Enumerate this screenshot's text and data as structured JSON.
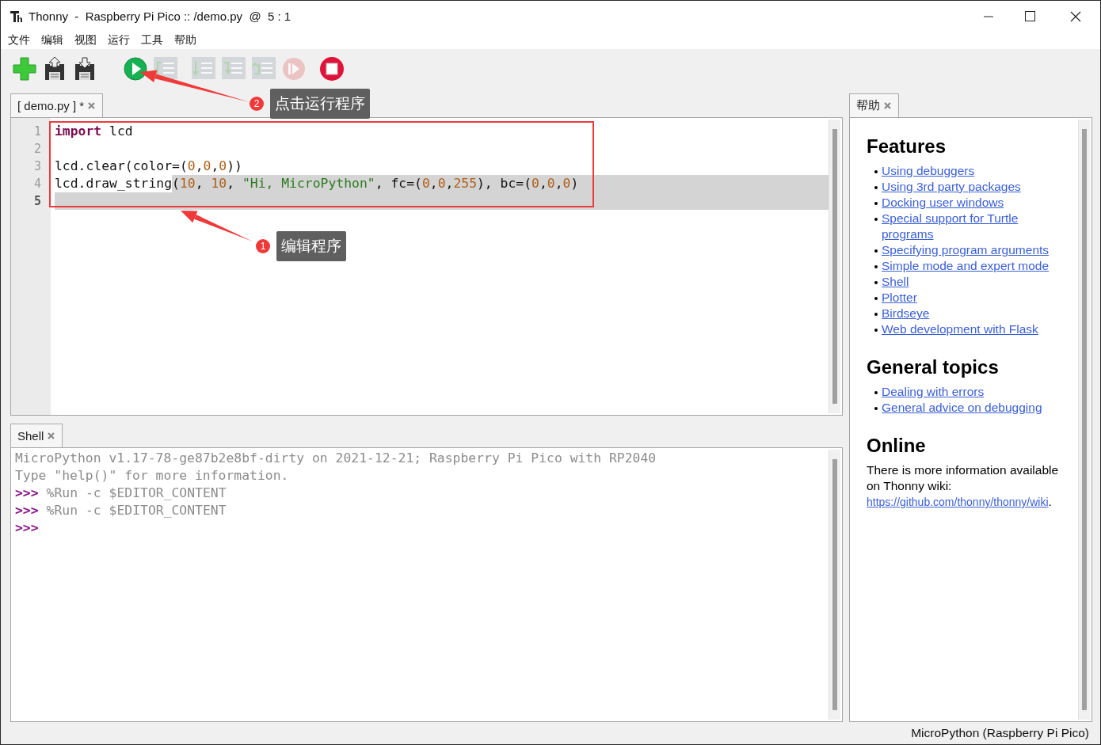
{
  "window": {
    "title": "Thonny  -  Raspberry Pi Pico :: /demo.py  @  5 : 1"
  },
  "menu": [
    "文件",
    "编辑",
    "视图",
    "运行",
    "工具",
    "帮助"
  ],
  "toolbar": [
    {
      "kind": "new",
      "disabled": false
    },
    {
      "kind": "load",
      "disabled": false
    },
    {
      "kind": "save",
      "disabled": false
    },
    {
      "kind": "run",
      "disabled": false
    },
    {
      "kind": "debug",
      "disabled": true
    },
    {
      "kind": "step_over",
      "disabled": true
    },
    {
      "kind": "step_into",
      "disabled": true
    },
    {
      "kind": "step_out",
      "disabled": true
    },
    {
      "kind": "resume",
      "disabled": true
    },
    {
      "kind": "stop",
      "disabled": false
    }
  ],
  "editor": {
    "tab": {
      "label": "[ demo.py ] *",
      "selected": true
    },
    "lines": [
      {
        "number": "1",
        "current": false,
        "selected": false,
        "tokens": [
          {
            "kind": "keyword",
            "text": "import",
            "selected": false
          },
          {
            "kind": "plain",
            "text": " lcd",
            "selected": false
          }
        ]
      },
      {
        "number": "2",
        "current": false,
        "selected": false
      },
      {
        "number": "3",
        "current": false,
        "selected": false,
        "tokens": [
          {
            "kind": "plain",
            "text": "lcd.clear(color=(",
            "selected": false
          },
          {
            "kind": "number",
            "text": "0",
            "selected": false
          },
          {
            "kind": "plain",
            "text": ",",
            "selected": false
          },
          {
            "kind": "number",
            "text": "0",
            "selected": false
          },
          {
            "kind": "plain",
            "text": ",",
            "selected": false
          },
          {
            "kind": "number",
            "text": "0",
            "selected": false
          },
          {
            "kind": "plain",
            "text": "))",
            "selected": false
          }
        ]
      },
      {
        "number": "4",
        "current": false,
        "selected": true,
        "tokens": [
          {
            "kind": "plain",
            "text": "lcd.draw_string",
            "selected": false
          },
          {
            "kind": "plain",
            "text": "(",
            "selected": true
          },
          {
            "kind": "number",
            "text": "10",
            "selected": true
          },
          {
            "kind": "plain",
            "text": ", ",
            "selected": true
          },
          {
            "kind": "number",
            "text": "10",
            "selected": true
          },
          {
            "kind": "plain",
            "text": ", ",
            "selected": true
          },
          {
            "kind": "string",
            "text": "\"Hi, MicroPython\"",
            "selected": true
          },
          {
            "kind": "plain",
            "text": ", fc=(",
            "selected": true
          },
          {
            "kind": "number",
            "text": "0",
            "selected": true
          },
          {
            "kind": "plain",
            "text": ",",
            "selected": true
          },
          {
            "kind": "number",
            "text": "0",
            "selected": true
          },
          {
            "kind": "plain",
            "text": ",",
            "selected": true
          },
          {
            "kind": "number",
            "text": "255",
            "selected": true
          },
          {
            "kind": "plain",
            "text": "), bc=(",
            "selected": true
          },
          {
            "kind": "number",
            "text": "0",
            "selected": true
          },
          {
            "kind": "plain",
            "text": ",",
            "selected": true
          },
          {
            "kind": "number",
            "text": "0",
            "selected": true
          },
          {
            "kind": "plain",
            "text": ",",
            "selected": true
          },
          {
            "kind": "number",
            "text": "0",
            "selected": true
          },
          {
            "kind": "plain",
            "text": ")",
            "selected": true
          }
        ]
      },
      {
        "number": "5",
        "current": true,
        "selected": true
      }
    ]
  },
  "shell": {
    "tab": {
      "label": "Shell",
      "selected": true
    },
    "lines": [
      {
        "kind": "output",
        "text": "MicroPython v1.17-78-ge87b2e8bf-dirty on 2021-12-21; Raspberry Pi Pico with RP2040"
      },
      {
        "kind": "output",
        "text": "Type \"help()\" for more information."
      },
      {
        "kind": "command",
        "prompt": ">>>",
        "text": "%Run -c $EDITOR_CONTENT"
      },
      {
        "kind": "command",
        "prompt": ">>>",
        "text": "%Run -c $EDITOR_CONTENT"
      },
      {
        "kind": "prompt",
        "prompt": ">>>"
      }
    ]
  },
  "help": {
    "tab": {
      "label": "帮助",
      "selected": true
    },
    "sections": [
      {
        "heading": "Features",
        "links": [
          "Using debuggers",
          "Using 3rd party packages",
          "Docking user windows",
          "Special support for Turtle programs",
          "Specifying program arguments",
          "Simple mode and expert mode",
          "Shell",
          "Plotter",
          "Birdseye",
          "Web development with Flask"
        ]
      },
      {
        "heading": "General topics",
        "links": [
          "Dealing with errors",
          "General advice on debugging"
        ]
      },
      {
        "heading": "Online",
        "paragraph": "There is more information available on Thonny wiki:",
        "link": "https://github.com/thonny/thonny/wiki",
        "after": "."
      }
    ]
  },
  "annotations": [
    {
      "number": "2",
      "text": "点击运行程序"
    },
    {
      "number": "1",
      "text": "编辑程序"
    }
  ],
  "status_bar": "MicroPython (Raspberry Pi Pico)"
}
